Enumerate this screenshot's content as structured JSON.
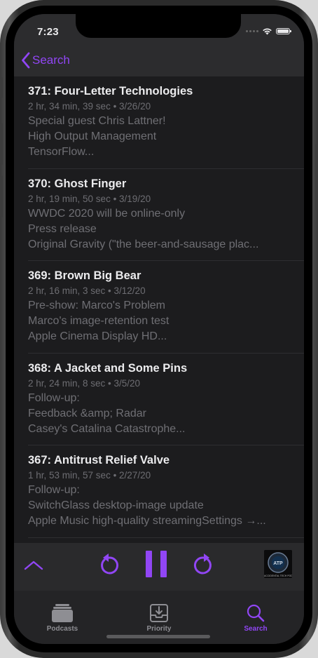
{
  "status_bar": {
    "time": "7:23"
  },
  "nav": {
    "back_label": "Search"
  },
  "episodes": [
    {
      "title": "371: Four-Letter Technologies",
      "meta": "2 hr, 34 min, 39 sec • 3/26/20",
      "lines": [
        "Special guest Chris Lattner!",
        "High Output Management",
        "TensorFlow..."
      ]
    },
    {
      "title": "370: Ghost Finger",
      "meta": "2 hr, 19 min, 50 sec • 3/19/20",
      "lines": [
        "WWDC 2020 will be online-only",
        "Press release",
        "Original Gravity (\"the beer-and-sausage plac..."
      ]
    },
    {
      "title": "369: Brown Big Bear",
      "meta": "2 hr, 16 min, 3 sec • 3/12/20",
      "lines": [
        "Pre-show: Marco's Problem",
        "Marco's image-retention test",
        "Apple Cinema Display HD..."
      ]
    },
    {
      "title": "368: A Jacket and Some Pins",
      "meta": "2 hr, 24 min, 8 sec • 3/5/20",
      "lines": [
        "Follow-up:",
        "Feedback &amp; Radar",
        "Casey's Catalina Catastrophe..."
      ]
    },
    {
      "title": "367: Antitrust Relief Valve",
      "meta": "1 hr, 53 min, 57 sec • 2/27/20",
      "lines": [
        "Follow-up:",
        "SwitchGlass desktop-image update",
        "Apple Music high-quality streamingSettings →..."
      ]
    }
  ],
  "player": {
    "artwork_text": "ACCIDENTAL TECH PODCAST",
    "artwork_icon": "microphone-badge-icon"
  },
  "tabs": [
    {
      "label": "Podcasts",
      "icon": "stack-icon",
      "active": false
    },
    {
      "label": "Priority",
      "icon": "tray-download-icon",
      "active": false
    },
    {
      "label": "Search",
      "icon": "magnifying-glass-icon",
      "active": true
    }
  ],
  "colors": {
    "accent": "#9146f5",
    "background": "#1c1c1e",
    "secondary_text": "#6d6d72"
  }
}
